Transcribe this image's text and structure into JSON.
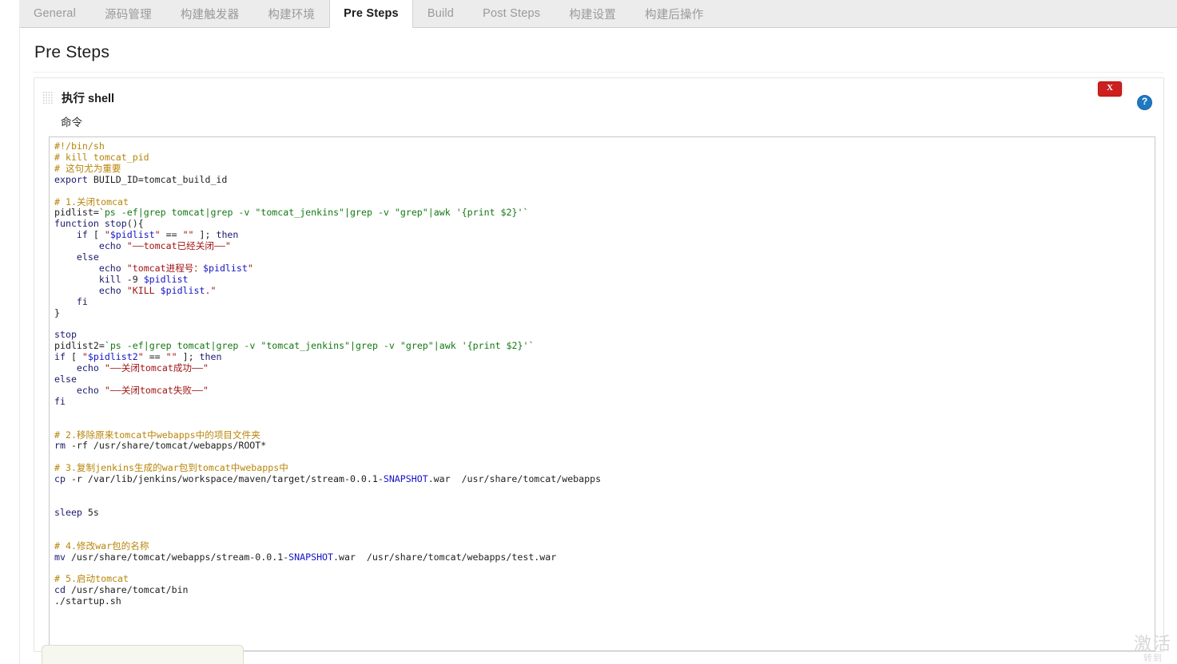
{
  "tabs": [
    {
      "label": "General",
      "active": false
    },
    {
      "label": "源码管理",
      "active": false
    },
    {
      "label": "构建触发器",
      "active": false
    },
    {
      "label": "构建环境",
      "active": false
    },
    {
      "label": "Pre Steps",
      "active": true
    },
    {
      "label": "Build",
      "active": false
    },
    {
      "label": "Post Steps",
      "active": false
    },
    {
      "label": "构建设置",
      "active": false
    },
    {
      "label": "构建后操作",
      "active": false
    }
  ],
  "page": {
    "title": "Pre Steps"
  },
  "step": {
    "name": "执行 shell",
    "command_label": "命令",
    "delete_label": "X",
    "help_label": "?",
    "command_value": "#!/bin/sh\n# kill tomcat_pid\n# 这句尤为重要\nexport BUILD_ID=tomcat_build_id\n\n# 1.关闭tomcat\npidlist=`ps -ef|grep tomcat|grep -v \"tomcat_jenkins\"|grep -v \"grep\"|awk '{print $2}'`\nfunction stop(){\n    if [ \"$pidlist\" == \"\" ]; then\n        echo \"——tomcat已经关闭——\"\n    else\n        echo \"tomcat进程号：$pidlist\"\n        kill -9 $pidlist\n        echo \"KILL $pidlist.\"\n    fi\n}\n\nstop\npidlist2=`ps -ef|grep tomcat|grep -v \"tomcat_jenkins\"|grep -v \"grep\"|awk '{print $2}'`\nif [ \"$pidlist2\" == \"\" ]; then\n    echo \"——关闭tomcat成功——\"\nelse\n    echo \"——关闭tomcat失败——\"\nfi\n\n\n# 2.移除原来tomcat中webapps中的项目文件夹\nrm -rf /usr/share/tomcat/webapps/ROOT*\n\n# 3.复制jenkins生成的war包到tomcat中webapps中\ncp -r /var/lib/jenkins/workspace/maven/target/stream-0.0.1-SNAPSHOT.war  /usr/share/tomcat/webapps\n\n\nsleep 5s\n\n\n# 4.修改war包的名称\nmv /usr/share/tomcat/webapps/stream-0.0.1-SNAPSHOT.war  /usr/share/tomcat/webapps/test.war\n\n# 5.启动tomcat\ncd /usr/share/tomcat/bin\n./startup.sh"
  },
  "watermark": {
    "line1": "激活",
    "line2": "转到"
  },
  "colors": {
    "accent_delete": "#cc1f1f",
    "accent_help": "#1f78c1",
    "comment": "#b8860b",
    "keyword": "#1a1a6e",
    "string": "#a01414",
    "variable": "#1414c8",
    "command": "#147814"
  }
}
